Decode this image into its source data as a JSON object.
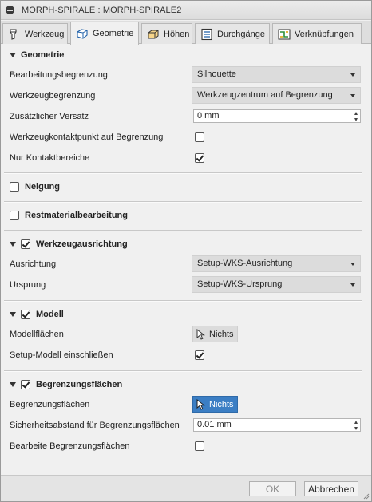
{
  "window": {
    "title": "MORPH-SPIRALE : MORPH-SPIRALE2"
  },
  "tabs": [
    {
      "label": "Werkzeug",
      "icon": "tool-icon"
    },
    {
      "label": "Geometrie",
      "icon": "geometry-cube-icon",
      "active": true
    },
    {
      "label": "Höhen",
      "icon": "heights-box-icon"
    },
    {
      "label": "Durchgänge",
      "icon": "passes-icon"
    },
    {
      "label": "Verknüpfungen",
      "icon": "linking-icon"
    }
  ],
  "geometrie": {
    "heading": "Geometrie",
    "bearbeitungsbegrenzung": {
      "label": "Bearbeitungsbegrenzung",
      "value": "Silhouette"
    },
    "werkzeugbegrenzung": {
      "label": "Werkzeugbegrenzung",
      "value": "Werkzeugzentrum auf Begrenzung"
    },
    "versatz": {
      "label": "Zusätzlicher Versatz",
      "value": "0 mm"
    },
    "kontaktpunkt": {
      "label": "Werkzeugkontaktpunkt auf Begrenzung",
      "checked": false
    },
    "kontaktbereiche": {
      "label": "Nur Kontaktbereiche",
      "checked": true
    }
  },
  "neigung": {
    "heading": "Neigung",
    "checked": false
  },
  "restmaterial": {
    "heading": "Restmaterialbearbeitung",
    "checked": false
  },
  "ausrichtung": {
    "heading": "Werkzeugausrichtung",
    "checked": true,
    "ausrichtung": {
      "label": "Ausrichtung",
      "value": "Setup-WKS-Ausrichtung"
    },
    "ursprung": {
      "label": "Ursprung",
      "value": "Setup-WKS-Ursprung"
    }
  },
  "modell": {
    "heading": "Modell",
    "checked": true,
    "flaechen": {
      "label": "Modellflächen",
      "button": "Nichts"
    },
    "einschliessen": {
      "label": "Setup-Modell einschließen",
      "checked": true
    }
  },
  "begrenzung": {
    "heading": "Begrenzungsflächen",
    "checked": true,
    "flaechen": {
      "label": "Begrenzungsflächen",
      "button": "Nichts"
    },
    "abstand": {
      "label": "Sicherheitsabstand für Begrenzungsflächen",
      "value": "0.01 mm"
    },
    "bearbeite": {
      "label": "Bearbeite Begrenzungsflächen",
      "checked": false
    }
  },
  "footer": {
    "ok": "OK",
    "cancel": "Abbrechen"
  },
  "colors": {
    "accent": "#3b7ec4",
    "panel": "#f0f0f0",
    "select": "#dcdcdc"
  }
}
